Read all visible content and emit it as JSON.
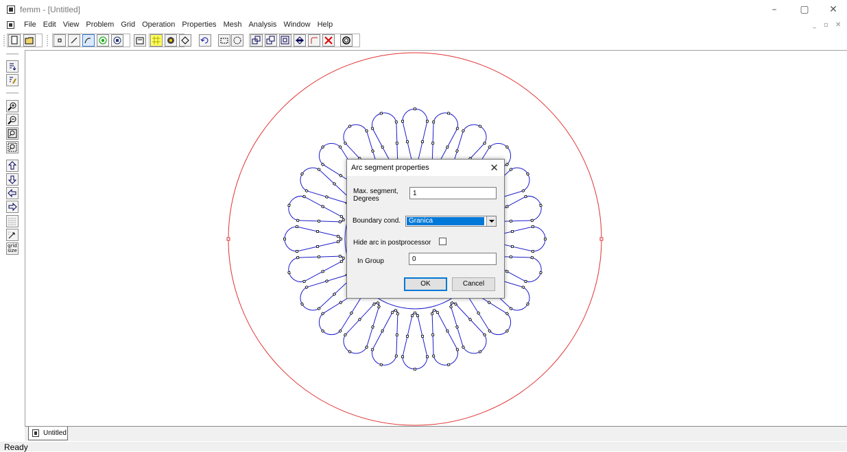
{
  "window": {
    "title": "femm - [Untitled]",
    "minimize": "–",
    "maximize": "▢",
    "close": "✕"
  },
  "menu": {
    "items": [
      "File",
      "Edit",
      "View",
      "Problem",
      "Grid",
      "Operation",
      "Properties",
      "Mesh",
      "Analysis",
      "Window",
      "Help"
    ],
    "mdi_min": "_",
    "mdi_restore": "▫",
    "mdi_close": "✕"
  },
  "toolbar": {
    "icons": [
      "new-file-icon",
      "open-folder-icon",
      "node-mode-icon",
      "segment-mode-icon",
      "arc-segment-mode-icon",
      "block-label-mode-icon",
      "group-mode-icon",
      "properties-icon",
      "grid-icon",
      "materials-icon",
      "boundary-icon",
      "undo-icon",
      "select-box-icon",
      "select-circle-icon",
      "copy-icon",
      "move-icon",
      "scale-icon",
      "mirror-icon",
      "fillet-icon",
      "delete-icon",
      "mesh-icon"
    ]
  },
  "vtoolbar": {
    "icons": [
      "show-mesh-icon",
      "show-names-icon",
      "zoom-in-icon",
      "zoom-out-icon",
      "zoom-natural-icon",
      "zoom-window-icon",
      "pan-up-icon",
      "pan-down-icon",
      "pan-left-icon",
      "pan-right-icon",
      "show-grid-icon",
      "snap-grid-icon"
    ],
    "grid_size_label_1": "grid",
    "grid_size_label_2": "size"
  },
  "document_tab": {
    "label": "Untitled"
  },
  "status": {
    "text": "Ready"
  },
  "dialog": {
    "title": "Arc segment properties",
    "max_segment_label_1": "Max. segment,",
    "max_segment_label_2": "Degrees",
    "max_segment_value": "1",
    "boundary_label": "Boundary cond.",
    "boundary_value": "Granica",
    "hide_arc_label": "Hide arc in postprocessor",
    "hide_arc_checked": false,
    "group_label": "In Group",
    "group_value": "0",
    "ok_label": "OK",
    "cancel_label": "Cancel"
  },
  "colors": {
    "boundary_circle": "#e03030",
    "geometry": "#1a1acc",
    "selection": "#0078d7"
  }
}
